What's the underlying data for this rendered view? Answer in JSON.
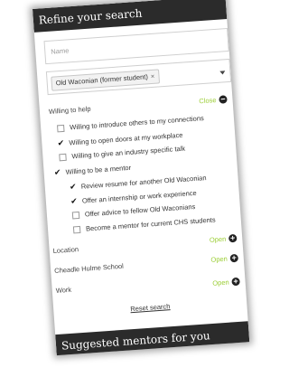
{
  "header": {
    "title": "Refine your search"
  },
  "name_field": {
    "placeholder": "Name"
  },
  "relationship_field": {
    "selected_tag": "Old Waconian (former student)",
    "remove_symbol": "×"
  },
  "willing": {
    "title": "Willing to help",
    "toggle_label": "Close",
    "toggle_symbol": "−",
    "options": [
      {
        "label": "Willing to introduce others to my connections",
        "checked": false
      },
      {
        "label": "Willing to open doors at my workplace",
        "checked": true
      },
      {
        "label": "Willing to give an industry specific talk",
        "checked": false
      },
      {
        "label": "Willing to be a mentor",
        "checked": true
      }
    ],
    "sub_options": [
      {
        "label": "Review resume for another Old Waconian",
        "checked": true
      },
      {
        "label": "Offer an internship or work experience",
        "checked": true
      },
      {
        "label": "Offer advice to fellow Old Waconians",
        "checked": false
      },
      {
        "label": "Become a mentor for current CHS students",
        "checked": false
      }
    ]
  },
  "filters": [
    {
      "label": "Location",
      "toggle_label": "Open",
      "toggle_symbol": "+"
    },
    {
      "label": "Cheadle Hulme School",
      "toggle_label": "Open",
      "toggle_symbol": "+"
    },
    {
      "label": "Work",
      "toggle_label": "Open",
      "toggle_symbol": "+"
    }
  ],
  "reset_label": "Reset search",
  "footer": {
    "title": "Suggested mentors for you"
  },
  "colors": {
    "bar": "#2b2b2b",
    "toggle_text": "#9acd32"
  },
  "check_glyph": "✔"
}
